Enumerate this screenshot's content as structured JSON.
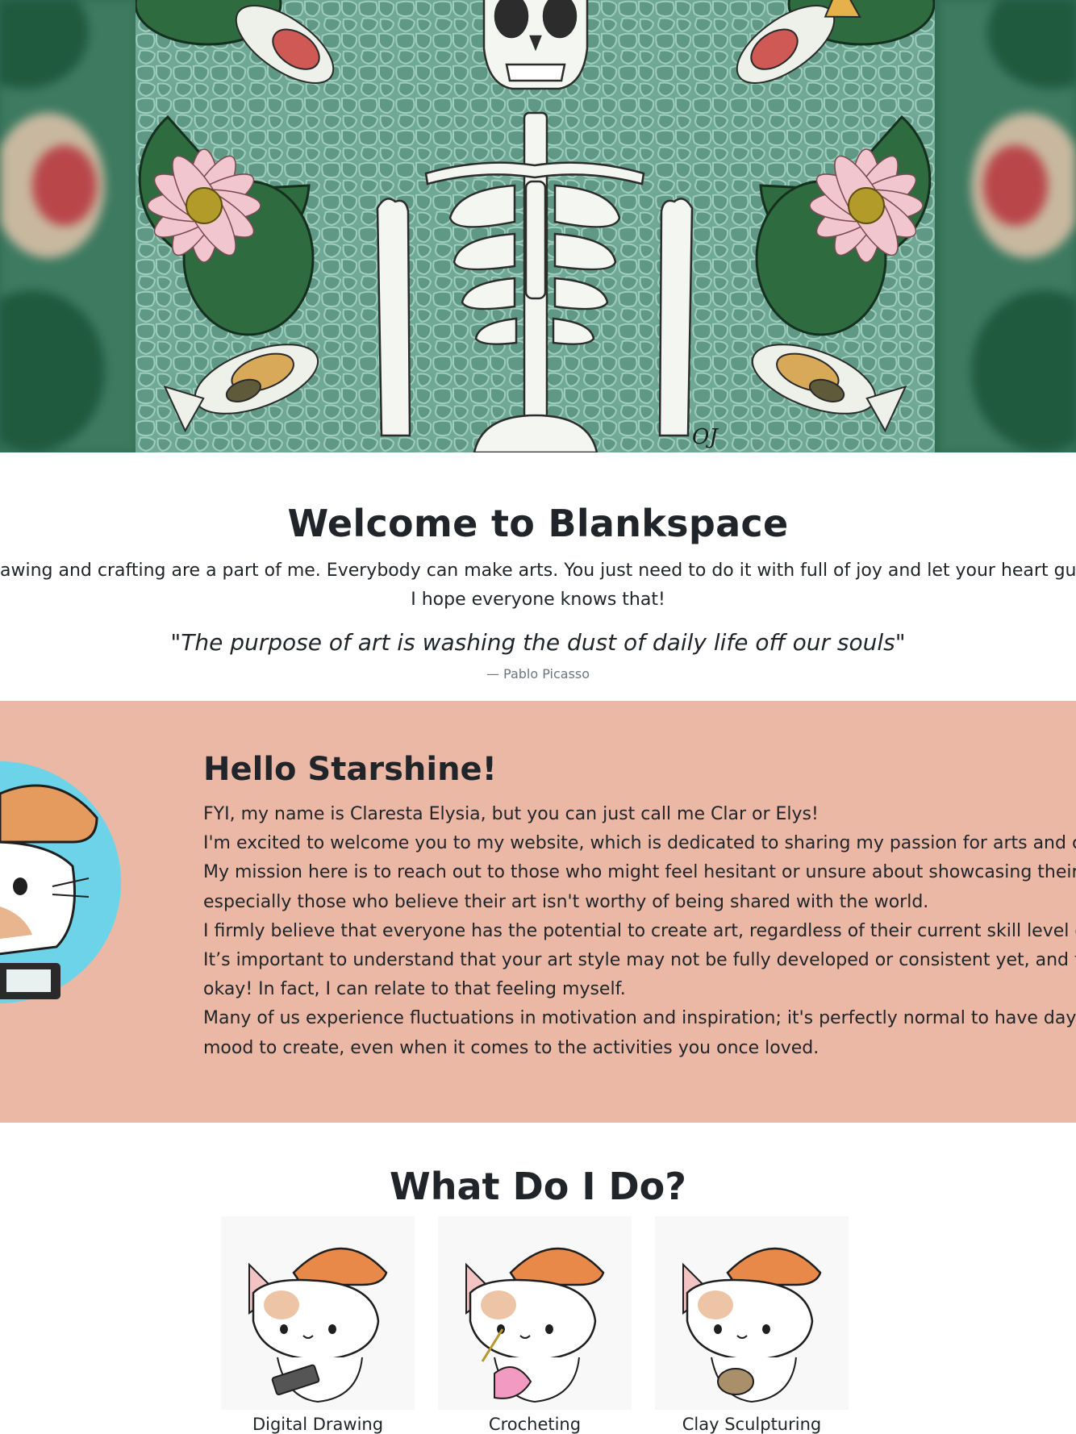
{
  "hero": {
    "alt": "Skeleton lying in a koi pond among water lilies"
  },
  "welcome": {
    "title": "Welcome to Blankspace",
    "text_line1": "awing and crafting are a part of me. Everybody can make arts. You just need to do it with full of joy and let your heart guide yo",
    "text_line2": "I hope everyone knows that!",
    "quote": "\"The purpose of art is washing the dust of daily life off our souls\"",
    "quote_author": "— Pablo Picasso"
  },
  "about": {
    "title": "Hello Starshine!",
    "lines": [
      "FYI, my name is Claresta Elysia, but you can just call me Clar or Elys!",
      "I'm excited to welcome you to my website, which is dedicated to sharing my passion for arts and crafts",
      "My mission here is to reach out to those who might feel hesitant or unsure about showcasing their crea",
      "especially those who believe their art isn't worthy of being shared with the world.",
      "I firmly believe that everyone has the potential to create art, regardless of their current skill level or arti",
      "It’s important to understand that your art style may not be fully developed or consistent yet, and that’s",
      "okay! In fact, I can relate to that feeling myself.",
      "Many of us experience fluctuations in motivation and inspiration; it's perfectly normal to have days whe",
      "mood to create, even when it comes to the activities you once loved."
    ]
  },
  "services": {
    "title": "What Do I Do?",
    "items": [
      {
        "label": "Digital Drawing"
      },
      {
        "label": "Crocheting"
      },
      {
        "label": "Clay Sculpturing"
      }
    ]
  },
  "colors": {
    "about_bg": "#ebb8a6",
    "pond": "#6aa48f",
    "text": "#212529",
    "muted": "#6c757d"
  }
}
